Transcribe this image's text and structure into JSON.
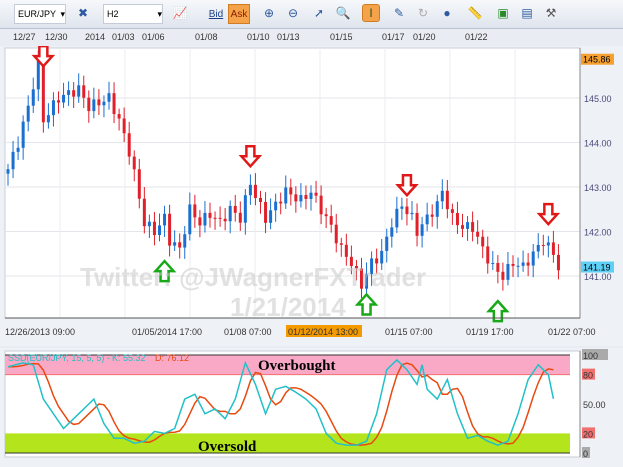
{
  "toolbar": {
    "symbol": "EUR/JPY",
    "timeframe": "H2",
    "bid": "Bid",
    "ask": "Ask",
    "icons": [
      "chart-type-icon",
      "indicator-icon",
      "bid-icon",
      "ask-icon",
      "zoom-in-icon",
      "zoom-out-icon",
      "cursor-icon",
      "zoom-icon",
      "crosshair-icon",
      "note-icon",
      "refresh-icon",
      "globe-icon",
      "ruler-icon",
      "image-icon",
      "print-icon",
      "tools-icon"
    ]
  },
  "top_dates": [
    "12/27",
    "12/30",
    "2014",
    "01/03",
    "01/06",
    "01/08",
    "01/10",
    "01/13",
    "01/15",
    "01/17",
    "01/20",
    "01/22"
  ],
  "bottom_dates": [
    "12/26/2013 09:00",
    "01/05/2014 17:00",
    "01/08 07:00",
    "01/12/2014 13:00",
    "01/15 07:00",
    "01/19 17:00",
    "01/22 07:00"
  ],
  "price_axis": {
    "labels": [
      "145.00",
      "144.00",
      "143.00",
      "142.00",
      "141.00"
    ],
    "high_badge": "145.86",
    "current_badge": "141.19"
  },
  "watermark": {
    "line1": "Twitter: @JWagnerFXTrader",
    "line2": "1/21/2014"
  },
  "stoch": {
    "label": "SSD(EUR/JPY, 15, 5, 5) -",
    "k_label": "K: 55.32",
    "d_label": "D: 76.12",
    "overbought": "Overbought",
    "oversold": "Oversold",
    "axis": [
      "100",
      "80",
      "50.00",
      "20",
      "0"
    ]
  },
  "colors": {
    "up": "#1a6fd0",
    "down": "#e0202a",
    "k": "#22c0c8",
    "d": "#e84a10",
    "ob": "#f9a9c6",
    "os": "#b4e41c"
  },
  "chart_data": {
    "type": "candlestick",
    "symbol": "EUR/JPY",
    "ylim": [
      140.5,
      146.1
    ],
    "price_keypoints": [
      [
        0,
        143.4
      ],
      [
        2,
        144
      ],
      [
        4,
        144.8
      ],
      [
        6,
        145.8
      ],
      [
        7,
        144.5
      ],
      [
        10,
        145
      ],
      [
        14,
        145.2
      ],
      [
        16,
        144.8
      ],
      [
        20,
        145
      ],
      [
        22,
        144.5
      ],
      [
        24,
        143.8
      ],
      [
        25,
        143.3
      ],
      [
        27,
        142.2
      ],
      [
        29,
        142
      ],
      [
        31,
        142.3
      ],
      [
        32,
        141.8
      ],
      [
        34,
        141.6
      ],
      [
        36,
        142.5
      ],
      [
        38,
        142.2
      ],
      [
        40,
        142.4
      ],
      [
        42,
        142.2
      ],
      [
        44,
        142.5
      ],
      [
        46,
        142.3
      ],
      [
        48,
        143.1
      ],
      [
        49,
        142.8
      ],
      [
        51,
        142.3
      ],
      [
        53,
        142.6
      ],
      [
        55,
        142.9
      ],
      [
        58,
        142.7
      ],
      [
        60,
        142.9
      ],
      [
        62,
        142.5
      ],
      [
        64,
        142.1
      ],
      [
        66,
        141.6
      ],
      [
        68,
        141.3
      ],
      [
        70,
        140.8
      ],
      [
        72,
        141.3
      ],
      [
        74,
        141.5
      ],
      [
        76,
        142.2
      ],
      [
        78,
        142.6
      ],
      [
        80,
        142.3
      ],
      [
        81,
        142
      ],
      [
        83,
        142.3
      ],
      [
        85,
        142.6
      ],
      [
        86,
        142.9
      ],
      [
        88,
        142.3
      ],
      [
        90,
        142.1
      ],
      [
        92,
        142.1
      ],
      [
        94,
        141.6
      ],
      [
        96,
        141.2
      ],
      [
        98,
        141
      ],
      [
        100,
        141.3
      ],
      [
        102,
        141.2
      ],
      [
        104,
        141.5
      ],
      [
        106,
        141.8
      ],
      [
        108,
        141.5
      ],
      [
        109,
        141.2
      ]
    ],
    "arrows": [
      {
        "dir": "down",
        "bar": 7,
        "price": 145.85
      },
      {
        "dir": "down",
        "bar": 48,
        "price": 143.6
      },
      {
        "dir": "down",
        "bar": 79,
        "price": 142.95
      },
      {
        "dir": "down",
        "bar": 107,
        "price": 142.3
      },
      {
        "dir": "up",
        "bar": 31,
        "price": 141.2
      },
      {
        "dir": "up",
        "bar": 71,
        "price": 140.45
      },
      {
        "dir": "up",
        "bar": 97,
        "price": 140.3
      }
    ],
    "stoch_k": [
      [
        0,
        88
      ],
      [
        3,
        92
      ],
      [
        5,
        90
      ],
      [
        7,
        55
      ],
      [
        11,
        25
      ],
      [
        15,
        45
      ],
      [
        17,
        55
      ],
      [
        19,
        30
      ],
      [
        21,
        15
      ],
      [
        23,
        15
      ],
      [
        25,
        10
      ],
      [
        27,
        12
      ],
      [
        29,
        22
      ],
      [
        31,
        20
      ],
      [
        33,
        25
      ],
      [
        35,
        55
      ],
      [
        37,
        60
      ],
      [
        39,
        40
      ],
      [
        41,
        45
      ],
      [
        43,
        35
      ],
      [
        45,
        55
      ],
      [
        47,
        92
      ],
      [
        49,
        70
      ],
      [
        51,
        40
      ],
      [
        53,
        65
      ],
      [
        55,
        68
      ],
      [
        57,
        62
      ],
      [
        59,
        55
      ],
      [
        61,
        45
      ],
      [
        63,
        20
      ],
      [
        65,
        10
      ],
      [
        67,
        8
      ],
      [
        69,
        8
      ],
      [
        71,
        12
      ],
      [
        73,
        40
      ],
      [
        75,
        85
      ],
      [
        77,
        95
      ],
      [
        79,
        85
      ],
      [
        81,
        70
      ],
      [
        82,
        90
      ],
      [
        83,
        65
      ],
      [
        85,
        55
      ],
      [
        87,
        75
      ],
      [
        89,
        40
      ],
      [
        91,
        15
      ],
      [
        93,
        18
      ],
      [
        95,
        12
      ],
      [
        97,
        8
      ],
      [
        99,
        12
      ],
      [
        101,
        40
      ],
      [
        103,
        75
      ],
      [
        105,
        90
      ],
      [
        107,
        80
      ],
      [
        108,
        55.32
      ]
    ]
  }
}
